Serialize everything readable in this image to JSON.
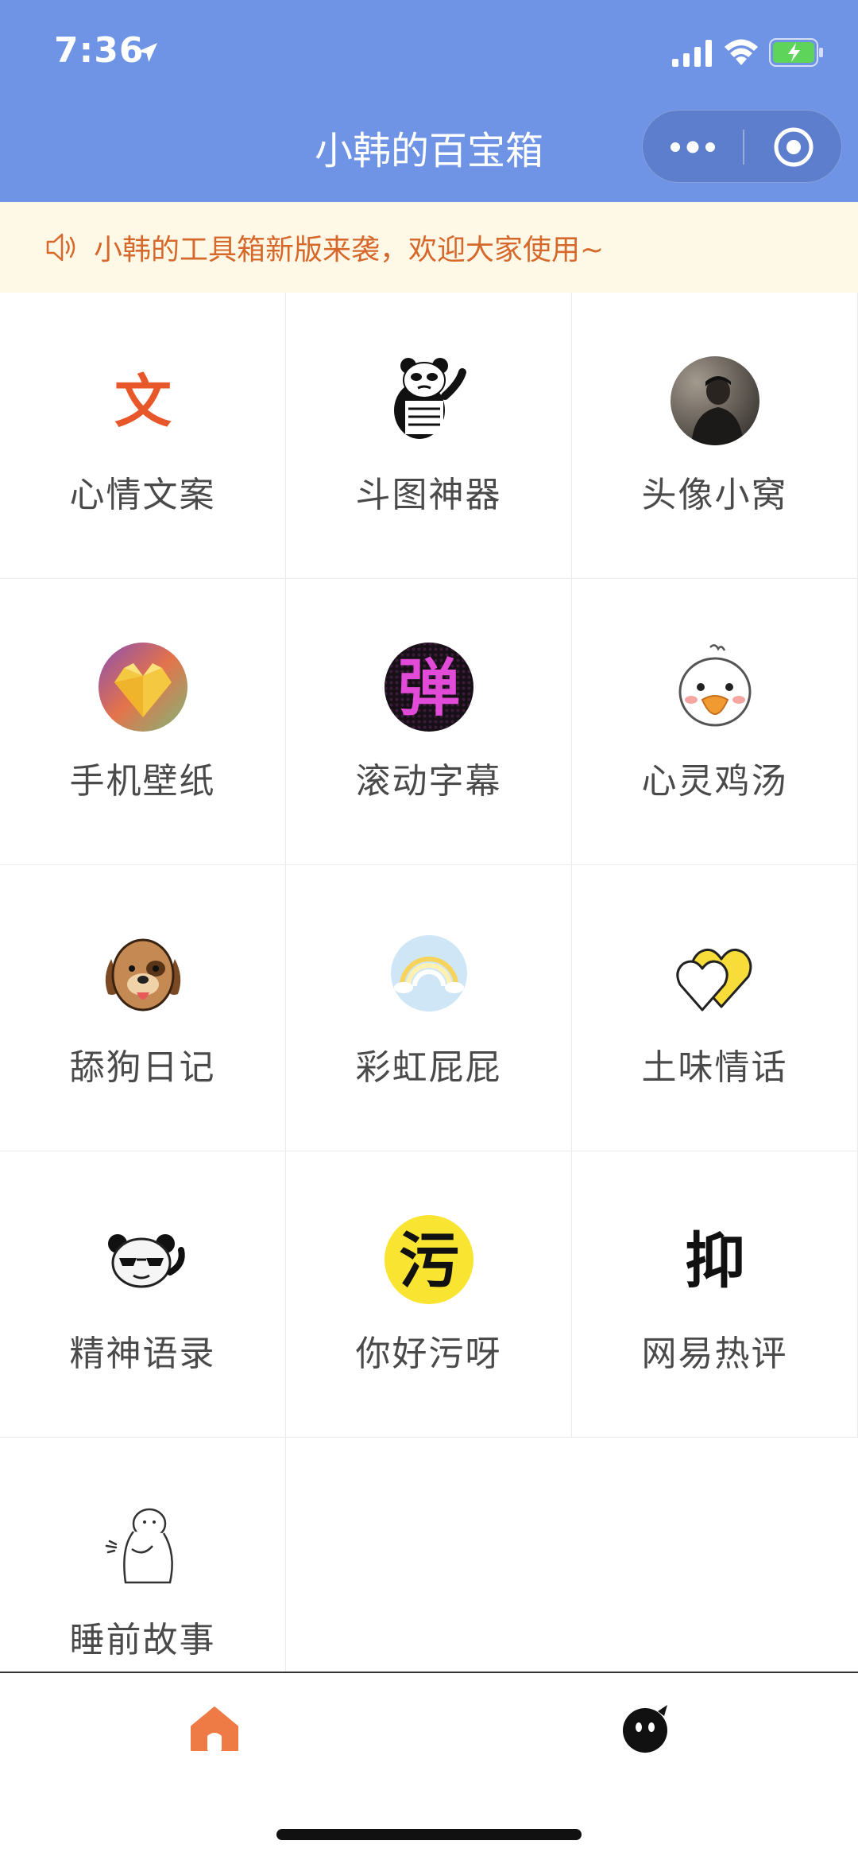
{
  "status": {
    "time": "7:36"
  },
  "nav": {
    "title": "小韩的百宝箱"
  },
  "notice": {
    "text": "小韩的工具箱新版来袭，欢迎大家使用~"
  },
  "tools": [
    {
      "label": "心情文案",
      "icon": "wen-character-icon"
    },
    {
      "label": "斗图神器",
      "icon": "panda-meme-icon"
    },
    {
      "label": "头像小窝",
      "icon": "avatar-photo-icon"
    },
    {
      "label": "手机壁纸",
      "icon": "gem-heart-icon"
    },
    {
      "label": "滚动字幕",
      "icon": "led-dan-icon"
    },
    {
      "label": "心灵鸡汤",
      "icon": "duck-icon"
    },
    {
      "label": "舔狗日记",
      "icon": "dog-icon"
    },
    {
      "label": "彩虹屁屁",
      "icon": "rainbow-icon"
    },
    {
      "label": "土味情话",
      "icon": "double-heart-icon"
    },
    {
      "label": "精神语录",
      "icon": "sunglasses-panda-icon"
    },
    {
      "label": "你好污呀",
      "icon": "wu-character-icon"
    },
    {
      "label": "网易热评",
      "icon": "yi-character-icon"
    },
    {
      "label": "睡前故事",
      "icon": "sketch-character-icon"
    }
  ],
  "icon_text": {
    "wen": "文",
    "dan": "弹",
    "wu": "污",
    "yi": "抑"
  },
  "tabbar": {
    "items": [
      {
        "icon": "home-icon"
      },
      {
        "icon": "mascot-icon"
      }
    ]
  },
  "colors": {
    "header": "#6f93e5",
    "notice_bg": "#fef9e6",
    "notice_text": "#d6682b",
    "home_active": "#ee7a45"
  }
}
